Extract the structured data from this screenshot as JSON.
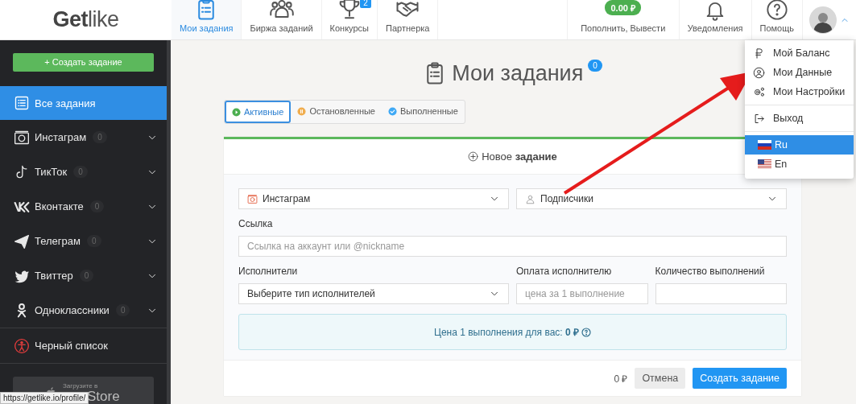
{
  "logo": {
    "bold": "Get",
    "light": "like"
  },
  "nav": [
    {
      "label": "Мои задания",
      "selected": true
    },
    {
      "label": "Биржа заданий",
      "selected": false
    },
    {
      "label": "Конкурсы",
      "badge": "2",
      "selected": false
    },
    {
      "label": "Партнерка",
      "selected": false
    }
  ],
  "balance": {
    "amount": "0.00 ₽",
    "label": "Пополнить, Вывести"
  },
  "notifications": {
    "label": "Уведомления"
  },
  "help": {
    "label": "Помощь"
  },
  "user_menu": {
    "expanded": true,
    "items": [
      {
        "label": "Мой Баланс"
      },
      {
        "label": "Мои Данные"
      },
      {
        "label": "Мои Настройки"
      },
      {
        "label": "Выход"
      }
    ],
    "languages": [
      {
        "code": "Ru",
        "selected": true
      },
      {
        "code": "En",
        "selected": false
      }
    ]
  },
  "sidebar": {
    "create_button": "+ Создать задание",
    "items": [
      {
        "label": "Все задания",
        "selected": true
      },
      {
        "label": "Инстаграм",
        "count": "0",
        "expanded": false,
        "selected": false
      },
      {
        "label": "ТикТок",
        "count": "0",
        "expanded": false,
        "selected": false
      },
      {
        "label": "Вконтакте",
        "count": "0",
        "expanded": false,
        "selected": false
      },
      {
        "label": "Телеграм",
        "count": "0",
        "expanded": false,
        "selected": false
      },
      {
        "label": "Твиттер",
        "count": "0",
        "expanded": false,
        "selected": false
      },
      {
        "label": "Одноклассники",
        "count": "0",
        "expanded": false,
        "selected": false
      },
      {
        "label": "Черный список",
        "selected": false
      }
    ],
    "app_store": {
      "line1": "Загрузите в",
      "line2": "Store"
    }
  },
  "status_url": "https://getlike.io/profile/",
  "page": {
    "title": "Мои задания",
    "count": "0",
    "filters": [
      {
        "label": "Активные",
        "selected": true
      },
      {
        "label": "Остановленные",
        "selected": false
      },
      {
        "label": "Выполненные",
        "selected": false
      }
    ]
  },
  "form": {
    "header": "Новое **задание**",
    "platform": {
      "value": "Инстаграм"
    },
    "task_type": {
      "value": "Подписчики"
    },
    "link": {
      "label": "Ссылка",
      "placeholder": "Ссылка на аккаунт или @nickname"
    },
    "performers": {
      "label": "Исполнители",
      "value": "Выберите тип исполнителей"
    },
    "payment": {
      "label": "Оплата исполнителю",
      "placeholder": "цена за 1 выполнение"
    },
    "quantity": {
      "label": "Количество выполнений"
    },
    "price_info": "Цена 1 выполнения для вас: **0 ₽**",
    "total": "0 ₽",
    "cancel": "Отмена",
    "submit": "Создать задание"
  }
}
